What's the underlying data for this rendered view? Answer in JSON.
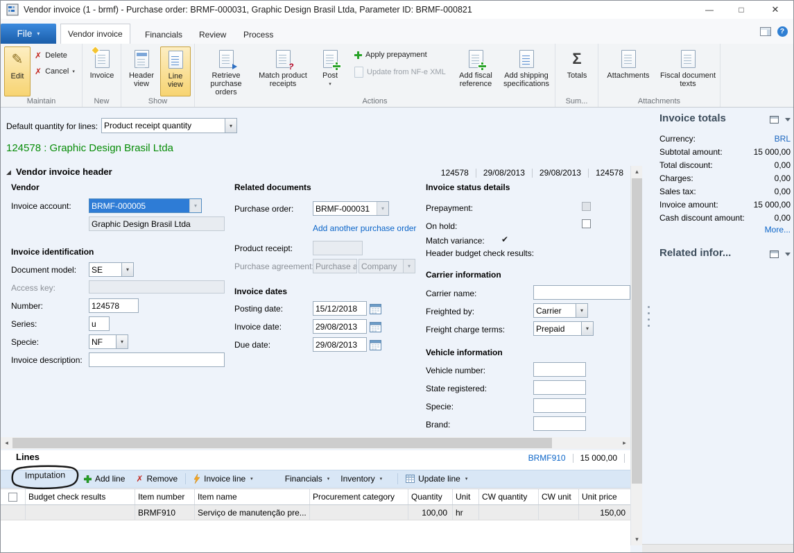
{
  "window": {
    "title": "Vendor invoice (1 - brmf) - Purchase order: BRMF-000031, Graphic Design Brasil Ltda, Parameter ID: BRMF-000821"
  },
  "icons": {
    "minimize": "—",
    "maximize": "□",
    "close": "✕",
    "dropdown": "▾",
    "check": "✔",
    "x_mark": "✗",
    "sigma": "Σ",
    "pencil": "✎",
    "expand_triangle": "◢",
    "help": "?",
    "arrow_up": "▴",
    "arrow_down": "▾",
    "arrow_left": "◂",
    "arrow_right": "▸"
  },
  "colors": {
    "selection_blue": "#2e7cd6",
    "record_green": "#078c07",
    "link_blue": "#0a64c8",
    "factbox_header": "#3d4d5c"
  },
  "ribbon": {
    "file": "File",
    "tabs": [
      "Vendor invoice",
      "Financials",
      "Review",
      "Process"
    ],
    "maintain": {
      "label": "Maintain",
      "edit": "Edit",
      "delete": "Delete",
      "cancel": "Cancel"
    },
    "new_group": {
      "label": "New",
      "invoice": "Invoice"
    },
    "show": {
      "label": "Show",
      "header_view": "Header view",
      "line_view": "Line view"
    },
    "actions": {
      "label": "Actions",
      "retrieve": "Retrieve purchase orders",
      "match": "Match product receipts",
      "post": "Post",
      "apply_prepayment": "Apply prepayment",
      "update_nfe": "Update from NF-e XML",
      "add_fiscal": "Add fiscal reference",
      "add_shipping": "Add shipping specifications"
    },
    "sum": {
      "label": "Sum...",
      "totals": "Totals"
    },
    "attach": {
      "label": "Attachments",
      "attachments": "Attachments",
      "fiscal_texts": "Fiscal document texts"
    }
  },
  "toolbar": {
    "default_qty_label": "Default quantity for lines:",
    "default_qty_value": "Product receipt quantity"
  },
  "record_title": "124578 : Graphic Design Brasil Ltda",
  "header": {
    "title": "Vendor invoice header",
    "summary": [
      "124578",
      "29/08/2013",
      "29/08/2013",
      "124578"
    ],
    "vendor": {
      "group_title": "Vendor",
      "invoice_account_label": "Invoice account:",
      "invoice_account_value": "BRMF-000005",
      "vendor_name": "Graphic Design Brasil Ltda"
    },
    "ident": {
      "group_title": "Invoice identification",
      "document_model_label": "Document model:",
      "document_model_value": "SE",
      "access_key_label": "Access key:",
      "number_label": "Number:",
      "number_value": "124578",
      "series_label": "Series:",
      "series_value": "u",
      "specie_label": "Specie:",
      "specie_value": "NF",
      "description_label": "Invoice description:"
    },
    "reldocs": {
      "group_title": "Related documents",
      "purchase_order_label": "Purchase order:",
      "purchase_order_value": "BRMF-000031",
      "add_po_link": "Add another purchase order",
      "product_receipt_label": "Product receipt:",
      "purchase_agreement_label": "Purchase agreement:",
      "purchase_agreement_value": "Purchase a",
      "purchase_agreement_company": "Company"
    },
    "dates": {
      "group_title": "Invoice dates",
      "posting_label": "Posting date:",
      "posting_value": "15/12/2018",
      "invoice_label": "Invoice date:",
      "invoice_value": "29/08/2013",
      "due_label": "Due date:",
      "due_value": "29/08/2013"
    },
    "status": {
      "group_title": "Invoice status details",
      "prepayment_label": "Prepayment:",
      "on_hold_label": "On hold:",
      "match_variance_label": "Match variance:",
      "match_check": "✔",
      "budget_label": "Header budget check results:"
    },
    "carrier": {
      "group_title": "Carrier information",
      "carrier_name_label": "Carrier name:",
      "freighted_by_label": "Freighted by:",
      "freighted_by_value": "Carrier",
      "freight_terms_label": "Freight charge terms:",
      "freight_terms_value": "Prepaid"
    },
    "vehicle": {
      "group_title": "Vehicle information",
      "vehicle_number_label": "Vehicle number:",
      "state_registered_label": "State registered:",
      "specie_label": "Specie:",
      "brand_label": "Brand:"
    }
  },
  "lines": {
    "title": "Lines",
    "summary_item": "BRMF910",
    "summary_amount": "15 000,00",
    "annotation": "Imputation",
    "toolbar": {
      "add_line": "Add line",
      "remove": "Remove",
      "invoice_line": "Invoice line",
      "financials": "Financials",
      "inventory": "Inventory",
      "update_line": "Update line"
    },
    "columns": [
      "Budget check results",
      "Item number",
      "Item name",
      "Procurement category",
      "Quantity",
      "Unit",
      "CW quantity",
      "CW unit",
      "Unit price"
    ],
    "row": {
      "item_number": "BRMF910",
      "item_name": "Serviço de manutenção pre...",
      "quantity": "100,00",
      "unit": "hr",
      "unit_price": "150,00"
    }
  },
  "factbox": {
    "totals": {
      "title": "Invoice totals",
      "rows": [
        {
          "label": "Currency:",
          "value": "BRL"
        },
        {
          "label": "Subtotal amount:",
          "value": "15 000,00"
        },
        {
          "label": "Total discount:",
          "value": "0,00"
        },
        {
          "label": "Charges:",
          "value": "0,00"
        },
        {
          "label": "Sales tax:",
          "value": "0,00"
        },
        {
          "label": "Invoice amount:",
          "value": "15 000,00"
        },
        {
          "label": "Cash discount amount:",
          "value": "0,00"
        }
      ],
      "more": "More..."
    },
    "related": {
      "title": "Related infor..."
    }
  }
}
